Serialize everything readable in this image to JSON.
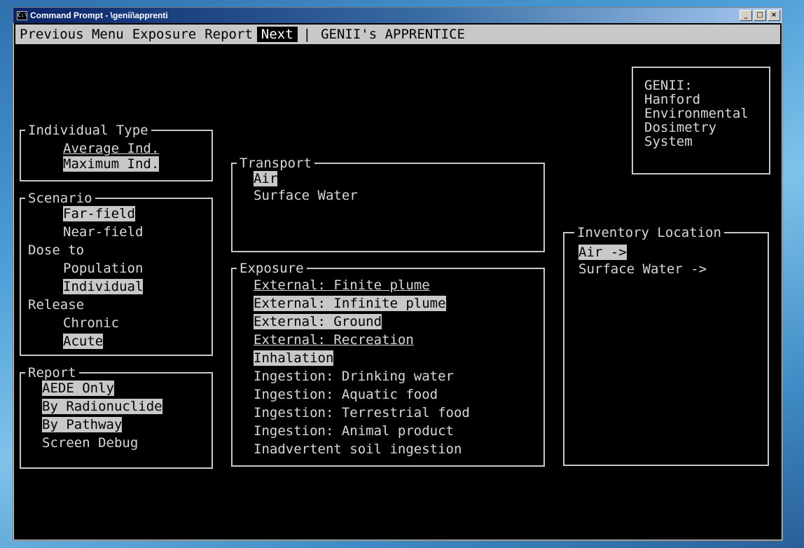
{
  "window": {
    "title": "Command Prompt - \\genii\\apprenti",
    "minimize": "_",
    "maximize": "□",
    "close": "×"
  },
  "menu": {
    "items": [
      "Previous Menu",
      "Exposure",
      "Report",
      "Next"
    ],
    "selected": "Next",
    "separator": "|",
    "app_title": "GENII's APPRENTICE"
  },
  "genii_box": {
    "lines": [
      "GENII:",
      "Hanford",
      "Environmental",
      "Dosimetry",
      "System"
    ]
  },
  "individual_type": {
    "title": "Individual Type",
    "options": [
      "Average Ind.",
      "Maximum Ind."
    ],
    "selected": "Maximum Ind."
  },
  "scenario": {
    "title": "Scenario",
    "far_field": "Far-field",
    "near_field": "Near-field",
    "dose_to": "Dose to",
    "population": "Population",
    "individual": "Individual",
    "release": "Release",
    "chronic": "Chronic",
    "acute": "Acute"
  },
  "report": {
    "title": "Report",
    "options": [
      "AEDE Only",
      "By Radionuclide",
      "By Pathway",
      "Screen Debug"
    ]
  },
  "transport": {
    "title": "Transport",
    "options": [
      "Air",
      "Surface Water"
    ]
  },
  "exposure": {
    "title": "Exposure",
    "options": [
      "External: Finite plume",
      "External: Infinite plume",
      "External: Ground",
      "External: Recreation",
      "Inhalation",
      "Ingestion: Drinking water",
      "Ingestion: Aquatic food",
      "Ingestion: Terrestrial food",
      "Ingestion: Animal product",
      "Inadvertent soil ingestion"
    ]
  },
  "inventory": {
    "title": "Inventory Location",
    "options": [
      "Air ->",
      "Surface Water ->"
    ]
  }
}
